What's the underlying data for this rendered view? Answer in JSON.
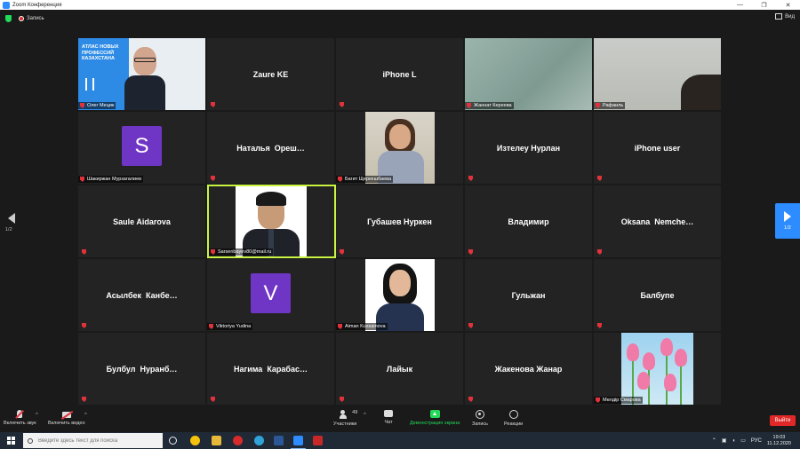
{
  "window": {
    "title": "Zoom Конференция",
    "minimize": "—",
    "maximize": "❐",
    "close": "✕"
  },
  "topbar": {
    "recording_label": "Запись",
    "view_label": "Вид"
  },
  "grid": {
    "tiles": [
      {
        "name": "Олег Мецик",
        "label": "Олег Мецик",
        "kind": "video"
      },
      {
        "name": "Zaure KE",
        "kind": "name"
      },
      {
        "name": "iPhone L",
        "kind": "name"
      },
      {
        "name": "Жаннат Кереева",
        "label": "Жаннат Кереева",
        "kind": "video"
      },
      {
        "name": "Рафаиль",
        "label": "Рафаиль",
        "kind": "video"
      },
      {
        "name": "Шакиржан Мурзагалиев",
        "label": "Шакиржан Мурзагалиев",
        "kind": "avatar",
        "letter": "S"
      },
      {
        "name": "Наталья  Ореш…",
        "kind": "name"
      },
      {
        "name": "Багит Щеркешбаева",
        "label": "Багит Щеркешбаева",
        "kind": "video"
      },
      {
        "name": "Изтелеу Нурлан",
        "kind": "name"
      },
      {
        "name": "iPhone user",
        "kind": "name"
      },
      {
        "name": "Saule Aidarova",
        "kind": "name"
      },
      {
        "name": "Sarsenbayev80@mail.ru",
        "label": "Sarsenbayev80@mail.ru",
        "kind": "video",
        "active": true
      },
      {
        "name": "Губашев Нуркен",
        "kind": "name"
      },
      {
        "name": "Владимир",
        "kind": "name"
      },
      {
        "name": "Oksana  Nemche…",
        "kind": "name"
      },
      {
        "name": "Асылбек  Канбе…",
        "kind": "name"
      },
      {
        "name": "Viktoriya Yudina",
        "label": "Viktoriya Yudina",
        "kind": "avatar",
        "letter": "V"
      },
      {
        "name": "Aiman Kussainova",
        "label": "Aiman Kussainova",
        "kind": "video"
      },
      {
        "name": "Гульжан",
        "kind": "name"
      },
      {
        "name": "Балбупе",
        "kind": "name"
      },
      {
        "name": "Булбул  Нуранб…",
        "kind": "name"
      },
      {
        "name": "Нагима  Карабас…",
        "kind": "name"
      },
      {
        "name": "Лайык",
        "kind": "name"
      },
      {
        "name": "Жакенова Жанар",
        "kind": "name"
      },
      {
        "name": "Мөлдір Смарова",
        "label": "Мөлдір Смарова",
        "kind": "video"
      }
    ]
  },
  "brand_banner": {
    "text": "АТЛАС НОВЫХ ПРОФЕССИЙ КАЗАХСТАНА"
  },
  "pager": {
    "left": "1/2",
    "right": "1/2"
  },
  "toolbar": {
    "audio": "Включить звук",
    "video": "Включить видео",
    "participants": "Участники",
    "participants_count": "49",
    "chat": "Чат",
    "share": "Демонстрация экрана",
    "record": "Запись",
    "reactions": "Реакции",
    "leave": "Выйти"
  },
  "taskbar": {
    "search_placeholder": "Введите здесь текст для поиска",
    "language": "РУС",
    "time": "19:03",
    "date": "11.12.2020",
    "tray_arrow": "⌃",
    "more": "…"
  },
  "colors": {
    "accent": "#2d8cff",
    "active_speaker": "#c9f542",
    "leave": "#e02828",
    "share": "#23d959",
    "avatar": "#6f35c4"
  }
}
